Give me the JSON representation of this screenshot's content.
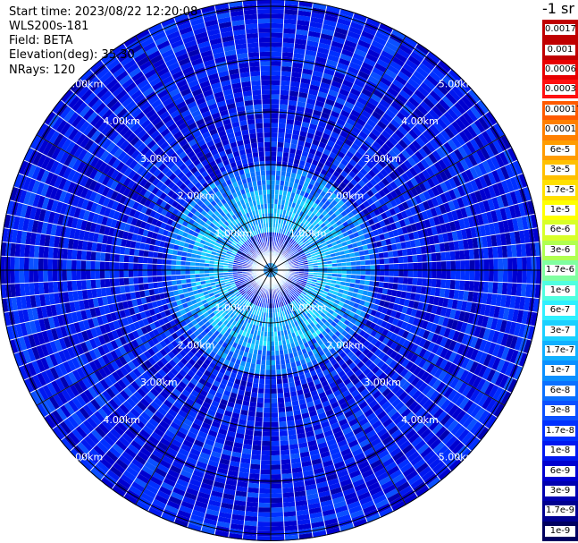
{
  "info": {
    "start_time": "Start time: 2023/08/22 12:20:08",
    "instrument": "WLS200s-181",
    "field": "Field: BETA",
    "elevation": "Elevation(deg): 35.30",
    "nrays": "NRays: 120"
  },
  "colorbar": {
    "unit": "-1 sr",
    "labels": [
      "0.0017",
      "0.001",
      "0.0006",
      "0.0003",
      "0.00017",
      "0.0001",
      "6e-5",
      "3e-5",
      "1.7e-5",
      "1e-5",
      "6e-6",
      "3e-6",
      "1.7e-6",
      "1e-6",
      "6e-7",
      "3e-7",
      "1.7e-7",
      "1e-7",
      "6e-8",
      "3e-8",
      "1.7e-8",
      "1e-8",
      "6e-9",
      "3e-9",
      "1.7e-9",
      "1e-9"
    ],
    "colors": [
      "#c00000",
      "#c00000",
      "#e80000",
      "#ff1010",
      "#ff5a00",
      "#ff7f00",
      "#ff9c00",
      "#ffc000",
      "#ffe000",
      "#ffff00",
      "#d8ff28",
      "#b0ff50",
      "#80ffa0",
      "#50ffe0",
      "#2ff0ff",
      "#1ad0ff",
      "#10b0ff",
      "#0a90ff",
      "#0a70ff",
      "#0a50ff",
      "#0030ff",
      "#0018f0",
      "#0000d0",
      "#0000b0",
      "#000090",
      "#000060"
    ]
  },
  "chart_data": {
    "type": "heatmap",
    "title": "",
    "field": "BETA",
    "elevation_deg": 35.3,
    "n_rays": 120,
    "range_rings_km": [
      1,
      2,
      3,
      4,
      5
    ],
    "range_ring_labels": [
      "1.00km",
      "2.00km",
      "3.00km",
      "4.00km",
      "5.00km"
    ],
    "max_range_km": 5.0,
    "radial_lines_deg": [
      0,
      30,
      60,
      90,
      120,
      150,
      180,
      210,
      240,
      270,
      300,
      330
    ],
    "bands": [
      {
        "from_km": 0.0,
        "to_km": 0.35,
        "beta": "1e-7"
      },
      {
        "from_km": 0.35,
        "to_km": 0.7,
        "beta": "1e-8"
      },
      {
        "from_km": 0.7,
        "to_km": 1.5,
        "beta": "1.7e-7"
      },
      {
        "from_km": 1.5,
        "to_km": 2.0,
        "beta": "6e-8"
      },
      {
        "from_km": 2.0,
        "to_km": 5.0,
        "beta": "1e-8"
      }
    ],
    "colorscale": "log, 1e-9 to 0.0017"
  }
}
